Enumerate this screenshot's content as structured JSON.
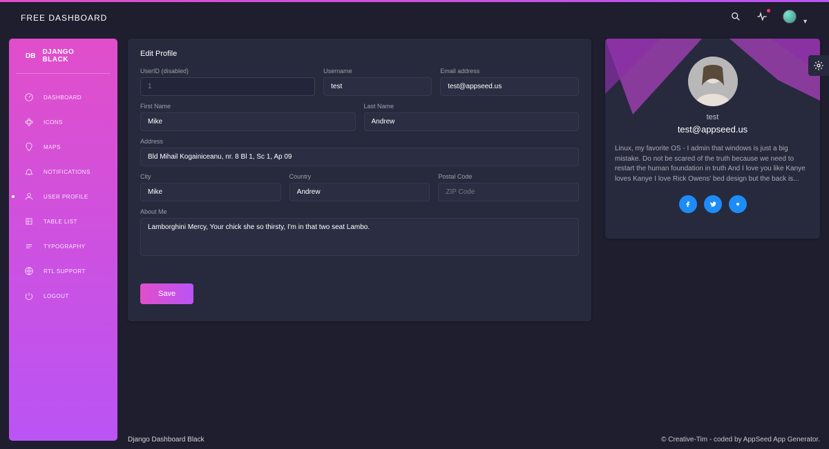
{
  "header": {
    "brand": "FREE DASHBOARD"
  },
  "sidebar": {
    "logo_short": "DB",
    "logo_text": "DJANGO BLACK",
    "items": [
      {
        "label": "DASHBOARD"
      },
      {
        "label": "ICONS"
      },
      {
        "label": "MAPS"
      },
      {
        "label": "NOTIFICATIONS"
      },
      {
        "label": "USER PROFILE"
      },
      {
        "label": "TABLE LIST"
      },
      {
        "label": "TYPOGRAPHY"
      },
      {
        "label": "RTL SUPPORT"
      },
      {
        "label": "LOGOUT"
      }
    ]
  },
  "form": {
    "title": "Edit Profile",
    "labels": {
      "userid": "UserID (disabled)",
      "username": "Username",
      "email": "Email address",
      "first_name": "First Name",
      "last_name": "Last Name",
      "address": "Address",
      "city": "City",
      "country": "Country",
      "postal": "Postal Code",
      "about": "About Me"
    },
    "values": {
      "userid": "1",
      "username": "test",
      "email": "test@appseed.us",
      "first_name": "Mike",
      "last_name": "Andrew",
      "address": "Bld Mihail Kogainiceanu, nr. 8 Bl 1, Sc 1, Ap 09",
      "city": "Mike",
      "country": "Andrew",
      "postal": "",
      "about": "Lamborghini Mercy, Your chick she so thirsty, I'm in that two seat Lambo."
    },
    "placeholders": {
      "postal": "ZIP Code"
    },
    "save_label": "Save"
  },
  "profile": {
    "name": "test",
    "email": "test@appseed.us",
    "desc": "Linux, my favorite OS - I admin that windows is just a big mistake. Do not be scared of the truth because we need to restart the human foundation in truth And I love you like Kanye loves Kanye I love Rick Owens' bed design but the back is..."
  },
  "footer": {
    "left": "Django Dashboard Black",
    "right": "© Creative-Tim - coded by AppSeed App Generator."
  }
}
